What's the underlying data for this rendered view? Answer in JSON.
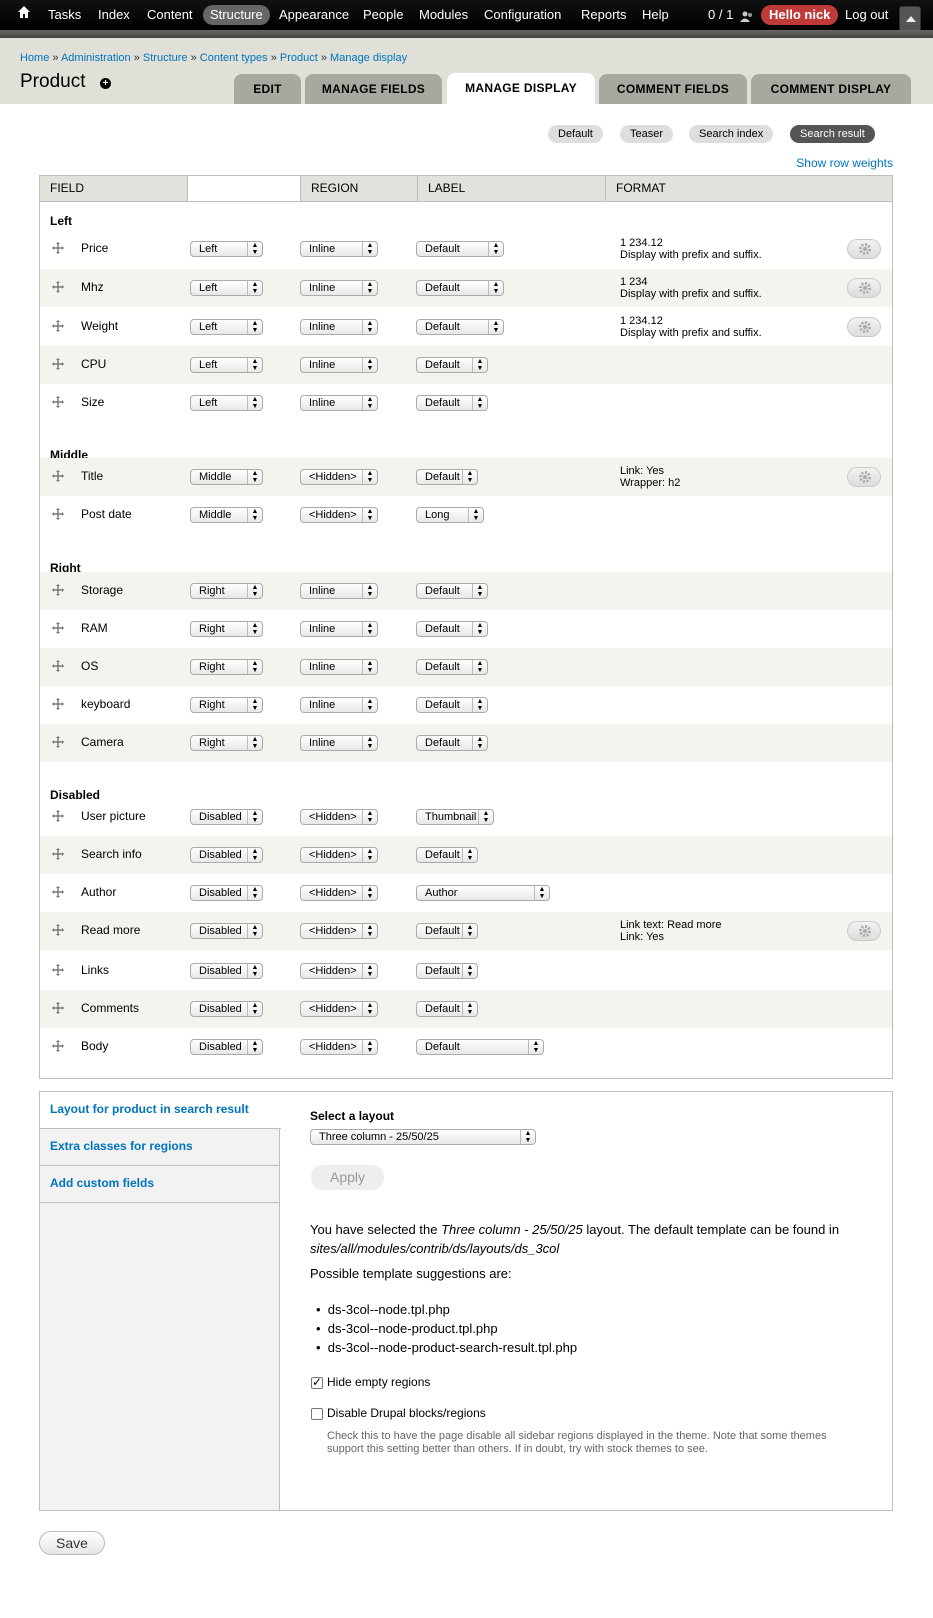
{
  "toolbar": {
    "items": [
      "Tasks",
      "Index",
      "Content",
      "Structure",
      "Appearance",
      "People",
      "Modules",
      "Configuration",
      "Reports",
      "Help"
    ],
    "counter": "0 / 1",
    "user": "Hello nick",
    "logout": "Log out"
  },
  "breadcrumb": [
    "Home",
    "Administration",
    "Structure",
    "Content types",
    "Product",
    "Manage display"
  ],
  "breadcrumb_sep": " » ",
  "title": "Product",
  "tabs": [
    "EDIT",
    "MANAGE FIELDS",
    "MANAGE DISPLAY",
    "COMMENT FIELDS",
    "COMMENT DISPLAY"
  ],
  "subtabs": [
    "Default",
    "Teaser",
    "Search index",
    "Search result"
  ],
  "row_weights": "Show row weights",
  "table": {
    "headers": [
      "FIELD",
      "",
      "REGION",
      "LABEL",
      "FORMAT"
    ],
    "regions": [
      "Left",
      "Middle",
      "Right",
      "Disabled"
    ],
    "rows": [
      {
        "name": "Price",
        "region": "Left",
        "label_pos": "Inline",
        "format": "Default",
        "summary1": "1 234.12",
        "summary2": "Display with prefix and suffix."
      },
      {
        "name": "Mhz",
        "region": "Left",
        "label_pos": "Inline",
        "format": "Default",
        "summary1": "1 234",
        "summary2": "Display with prefix and suffix."
      },
      {
        "name": "Weight",
        "region": "Left",
        "label_pos": "Inline",
        "format": "Default",
        "summary1": "1 234.12",
        "summary2": "Display with prefix and suffix."
      },
      {
        "name": "CPU",
        "region": "Left",
        "label_pos": "Inline",
        "format": "Default"
      },
      {
        "name": "Size",
        "region": "Left",
        "label_pos": "Inline",
        "format": "Default"
      },
      {
        "name": "Title",
        "region": "Middle",
        "label_pos": "<Hidden>",
        "format": "Default",
        "summary1": "Link: Yes",
        "summary2": "Wrapper: h2"
      },
      {
        "name": "Post date",
        "region": "Middle",
        "label_pos": "<Hidden>",
        "format": "Long"
      },
      {
        "name": "Storage",
        "region": "Right",
        "label_pos": "Inline",
        "format": "Default"
      },
      {
        "name": "RAM",
        "region": "Right",
        "label_pos": "Inline",
        "format": "Default"
      },
      {
        "name": "OS",
        "region": "Right",
        "label_pos": "Inline",
        "format": "Default"
      },
      {
        "name": "keyboard",
        "region": "Right",
        "label_pos": "Inline",
        "format": "Default"
      },
      {
        "name": "Camera",
        "region": "Right",
        "label_pos": "Inline",
        "format": "Default"
      },
      {
        "name": "User picture",
        "region": "Disabled",
        "label_pos": "<Hidden>",
        "format": "Thumbnail"
      },
      {
        "name": "Search info",
        "region": "Disabled",
        "label_pos": "<Hidden>",
        "format": "Default"
      },
      {
        "name": "Author",
        "region": "Disabled",
        "label_pos": "<Hidden>",
        "format": "Author"
      },
      {
        "name": "Read more",
        "region": "Disabled",
        "label_pos": "<Hidden>",
        "format": "Default",
        "summary1": "Link text: Read more",
        "summary2": "Link: Yes"
      },
      {
        "name": "Links",
        "region": "Disabled",
        "label_pos": "<Hidden>",
        "format": "Default"
      },
      {
        "name": "Comments",
        "region": "Disabled",
        "label_pos": "<Hidden>",
        "format": "Default"
      },
      {
        "name": "Body",
        "region": "Disabled",
        "label_pos": "<Hidden>",
        "format": "Default"
      }
    ]
  },
  "vtabs": [
    "Layout for product in search result",
    "Extra classes for regions",
    "Add custom fields"
  ],
  "layout": {
    "select_label": "Select a layout",
    "selected": "Three column - 25/50/25",
    "apply": "Apply",
    "msg_1": "You have selected the ",
    "msg_layout": "Three column - 25/50/25",
    "msg_2": " layout. The default template can be found in ",
    "msg_path": "sites/all/modules/contrib/ds/layouts/ds_3col",
    "suggest_title": "Possible template suggestions are:",
    "suggestions": [
      "ds-3col--node.tpl.php",
      "ds-3col--node-product.tpl.php",
      "ds-3col--node-product-search-result.tpl.php"
    ],
    "hide_empty": "Hide empty regions",
    "disable_blocks": "Disable Drupal blocks/regions",
    "disable_desc": "Check this to have the page disable all sidebar regions displayed in the theme. Note that some themes support this setting better than others. If in doubt, try with stock themes to see."
  },
  "save": "Save"
}
